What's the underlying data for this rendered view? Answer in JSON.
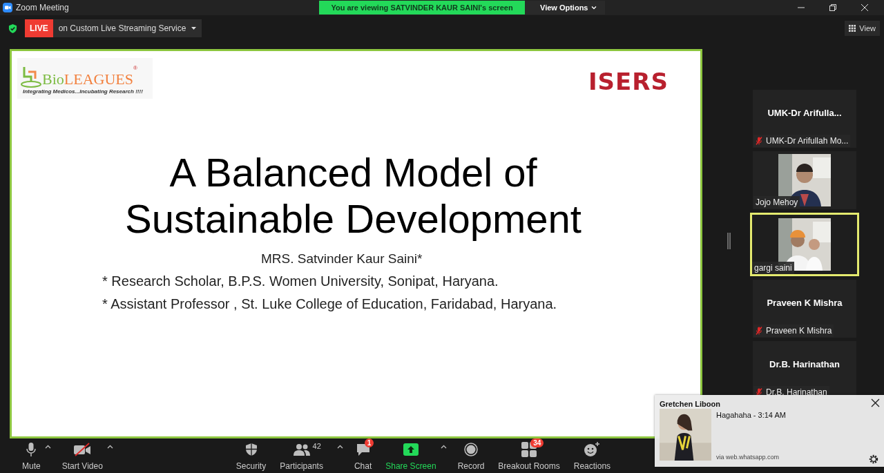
{
  "window": {
    "title": "Zoom Meeting",
    "banner": "You are viewing SATVINDER KAUR SAINI's screen",
    "view_options": "View Options"
  },
  "status_bar": {
    "live_badge": "LIVE",
    "stream": "on Custom Live Streaming Service",
    "view": "View"
  },
  "slide": {
    "logo_left": {
      "name_start": "Bio",
      "name_end": "LEAGUES",
      "registered": "®",
      "tagline": "Integrating Medicos...Incubating Research !!!!"
    },
    "logo_right": "ISERS",
    "title_lines": [
      "A Balanced Model of",
      "Sustainable Development"
    ],
    "author": "MRS. Satvinder Kaur Saini*",
    "notes": [
      "* Research Scholar, B.P.S. Women University, Sonipat, Haryana.",
      "* Assistant Professor , St. Luke College of Education, Faridabad, Haryana."
    ]
  },
  "participants": [
    {
      "kind": "name",
      "display": "UMK-Dr  Arifulla...",
      "label": "UMK-Dr Arifullah Mo...",
      "muted": true,
      "active": false
    },
    {
      "kind": "video",
      "label": "Jojo Mehoy",
      "muted": false,
      "active": false
    },
    {
      "kind": "video",
      "label": "gargi saini",
      "muted": false,
      "active": true
    },
    {
      "kind": "name",
      "display": "Praveen K Mishra",
      "label": "Praveen K Mishra",
      "muted": true,
      "active": false
    },
    {
      "kind": "name",
      "display": "Dr.B. Harinathan",
      "label": "Dr.B. Harinathan",
      "muted": true,
      "active": false
    }
  ],
  "toolbar": [
    {
      "kind": "mic",
      "label": "Mute",
      "caret": true,
      "highlight": false
    },
    {
      "kind": "video-off",
      "label": "Start Video",
      "caret": true,
      "highlight": false
    },
    {
      "kind": "security",
      "label": "Security",
      "caret": false,
      "highlight": false
    },
    {
      "kind": "participants",
      "label": "Participants",
      "count": "42",
      "caret": true,
      "highlight": false
    },
    {
      "kind": "chat",
      "label": "Chat",
      "badge": "1",
      "caret": false,
      "highlight": false
    },
    {
      "kind": "share",
      "label": "Share Screen",
      "caret": true,
      "highlight": true
    },
    {
      "kind": "record",
      "label": "Record",
      "caret": false,
      "highlight": false
    },
    {
      "kind": "breakout",
      "label": "Breakout Rooms",
      "badge": "34",
      "caret": false,
      "highlight": false
    },
    {
      "kind": "reactions",
      "label": "Reactions",
      "caret": false,
      "highlight": false
    }
  ],
  "notification": {
    "sender": "Gretchen Liboon",
    "message": "Hagahaha - 3:14 AM",
    "source": "via web.whatsapp.com"
  }
}
